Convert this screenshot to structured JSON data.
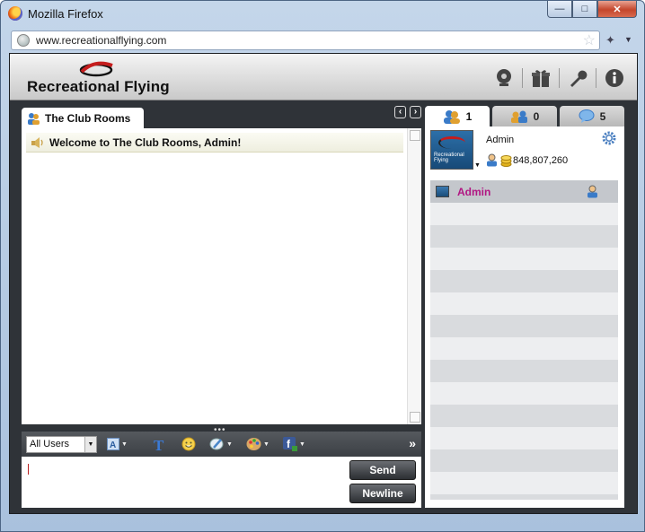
{
  "window": {
    "title": "Mozilla Firefox"
  },
  "browser": {
    "url": "www.recreationalflying.com"
  },
  "app": {
    "logo_text": "Recreational Flying"
  },
  "header_icons": [
    "webcam-icon",
    "gift-icon",
    "wrench-icon",
    "info-icon"
  ],
  "chat": {
    "tab_label": "The Club Rooms",
    "welcome_message": "Welcome to The Club Rooms, Admin!",
    "recipient_select": "All Users",
    "input_value": "",
    "send_label": "Send",
    "newline_label": "Newline",
    "toolbar_icons": [
      "font-icon",
      "text-style-icon",
      "emoticon-icon",
      "brush-icon",
      "palette-icon",
      "facebook-icon",
      "expand-icon"
    ]
  },
  "right_tabs": [
    {
      "icon": "users-icon",
      "count": "1",
      "active": true
    },
    {
      "icon": "group-icon",
      "count": "0",
      "active": false
    },
    {
      "icon": "chat-bubble-icon",
      "count": "5",
      "active": false
    }
  ],
  "profile": {
    "name": "Admin",
    "avatar_label": "Recreational Flying",
    "coins": "848,807,260"
  },
  "users": [
    {
      "name": "Admin",
      "name_color": "#b11783"
    }
  ],
  "colors": {
    "app_bg": "#2f3338",
    "username_accent": "#b11783",
    "logo_red": "#c51d1d"
  }
}
